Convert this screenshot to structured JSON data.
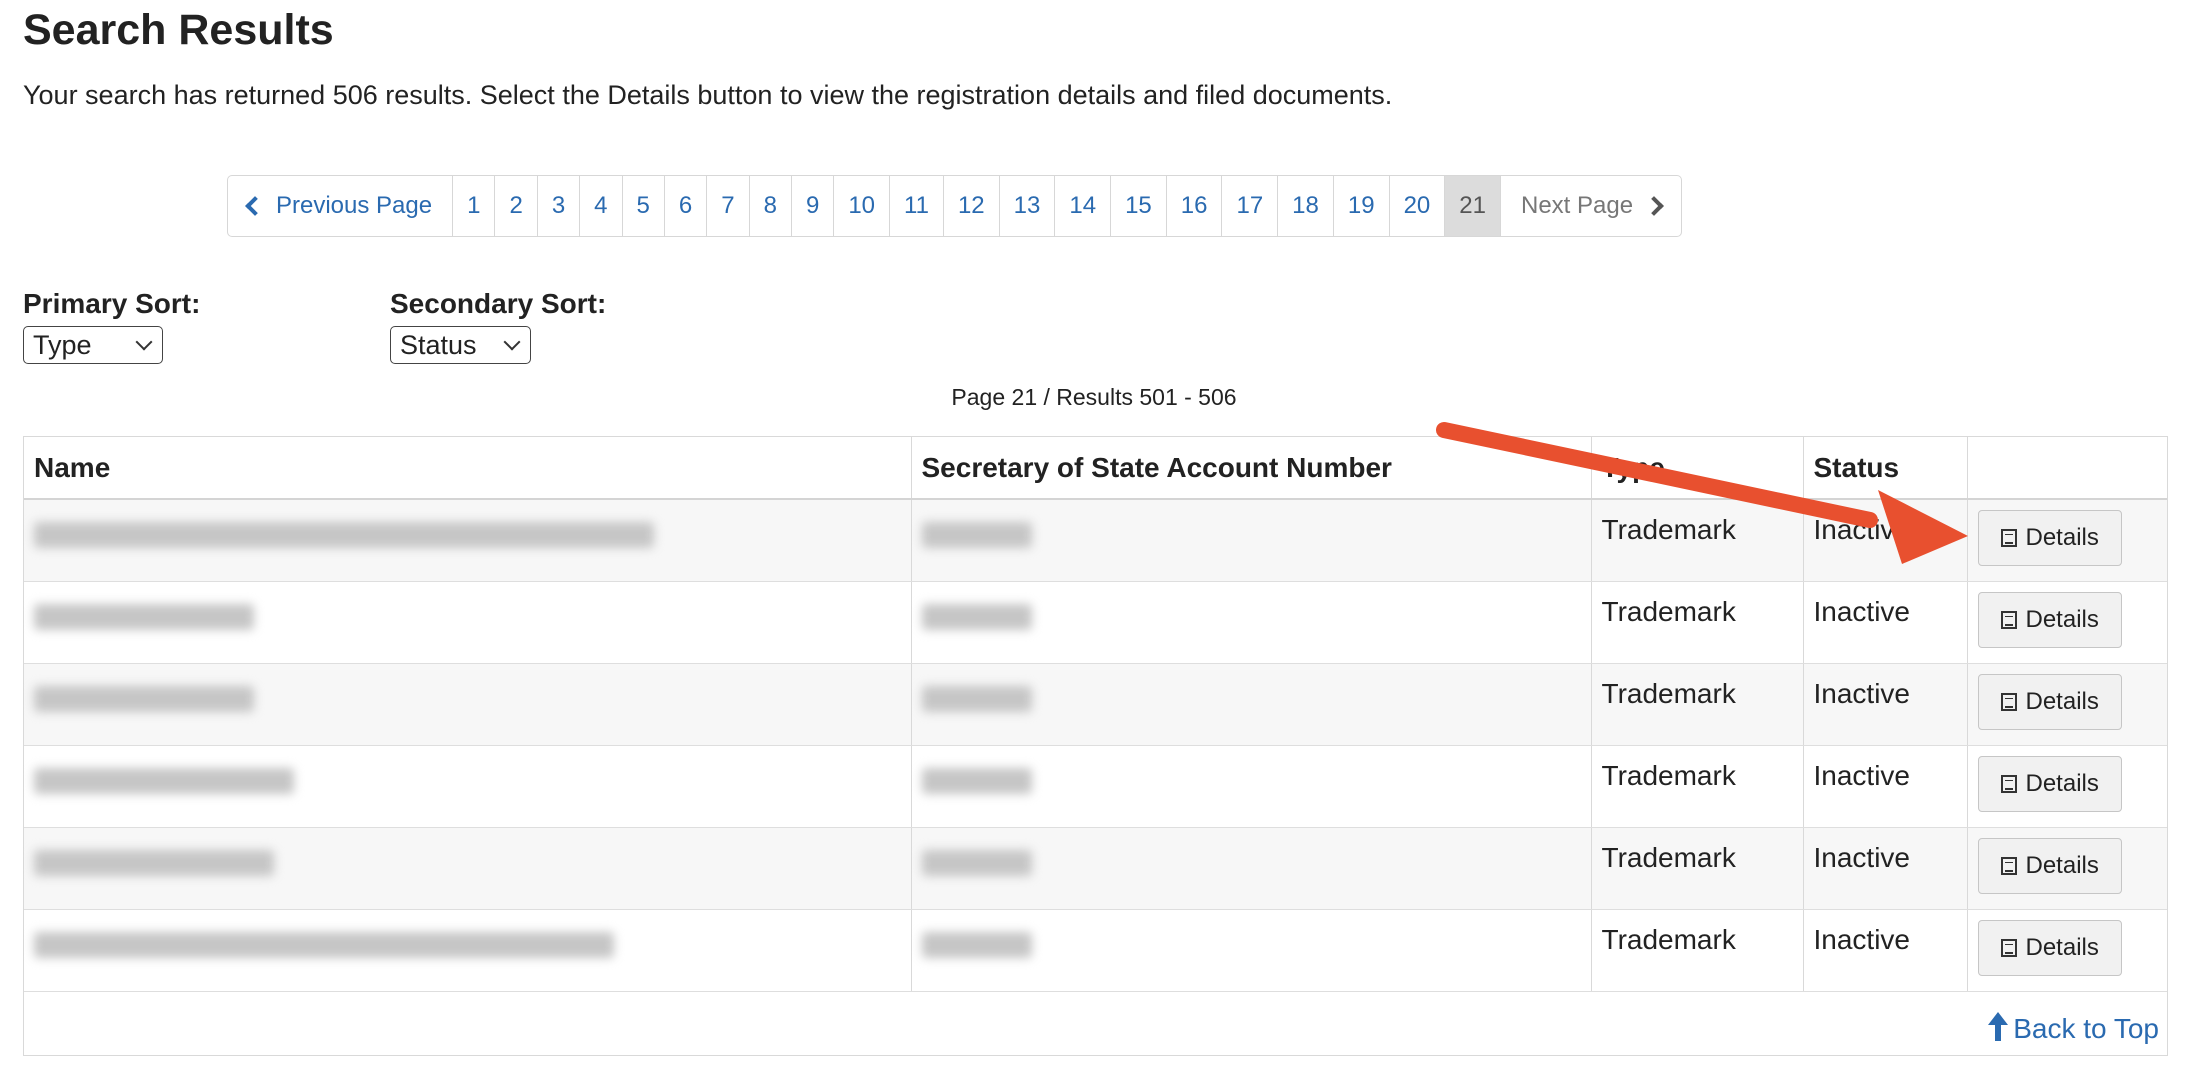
{
  "header": {
    "title": "Search Results",
    "intro": "Your search has returned 506 results. Select the Details button to view the registration details and filed documents."
  },
  "pagination": {
    "previous_label": "Previous Page",
    "next_label": "Next Page",
    "pages": [
      "1",
      "2",
      "3",
      "4",
      "5",
      "6",
      "7",
      "8",
      "9",
      "10",
      "11",
      "12",
      "13",
      "14",
      "15",
      "16",
      "17",
      "18",
      "19",
      "20",
      "21"
    ],
    "current": "21"
  },
  "sorts": {
    "primary_label": "Primary Sort:",
    "primary_value": "Type",
    "secondary_label": "Secondary Sort:",
    "secondary_value": "Status"
  },
  "page_info": "Page 21 / Results 501 - 506",
  "table": {
    "headers": [
      "Name",
      "Secretary of State Account Number",
      "Type",
      "Status",
      ""
    ],
    "rows": [
      {
        "type": "Trademark",
        "status": "Inactive",
        "details_label": "Details"
      },
      {
        "type": "Trademark",
        "status": "Inactive",
        "details_label": "Details"
      },
      {
        "type": "Trademark",
        "status": "Inactive",
        "details_label": "Details"
      },
      {
        "type": "Trademark",
        "status": "Inactive",
        "details_label": "Details"
      },
      {
        "type": "Trademark",
        "status": "Inactive",
        "details_label": "Details"
      },
      {
        "type": "Trademark",
        "status": "Inactive",
        "details_label": "Details"
      }
    ],
    "back_to_top": "Back to Top"
  },
  "icons": {
    "previous": "chevron-left-icon",
    "next": "chevron-right-icon",
    "details": "list-icon",
    "back_to_top": "arrow-up-icon",
    "annotation": "red-arrow-annotation"
  },
  "colors": {
    "link": "#2a6ab0",
    "active_page_bg": "#dcdcdc",
    "annotation_arrow": "#e8502f"
  }
}
